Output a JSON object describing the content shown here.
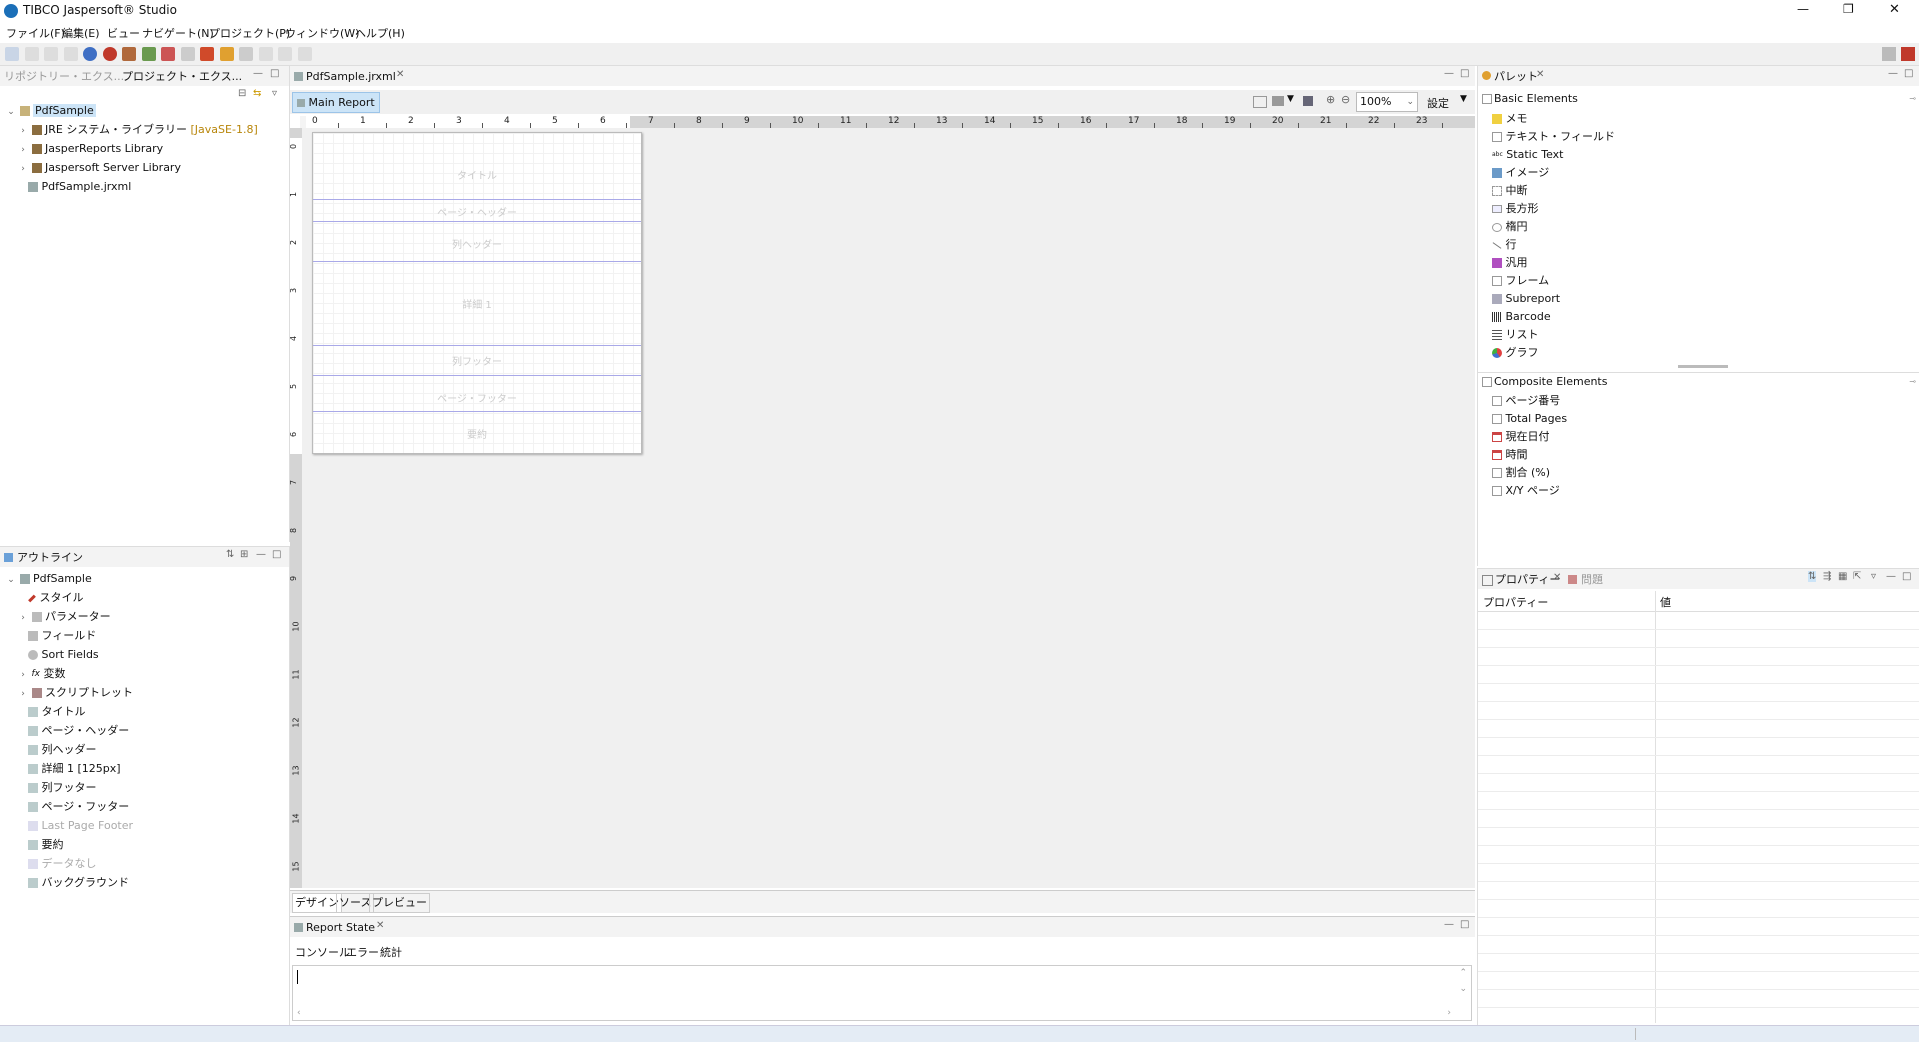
{
  "window": {
    "title": "TIBCO Jaspersoft® Studio",
    "controls": {
      "minimize": "—",
      "maximize": "❐",
      "close": "✕"
    }
  },
  "menu": [
    "ファイル(F)",
    "編集(E)",
    "ビュー",
    "ナビゲート(N)",
    "プロジェクト(P)",
    "ウィンドウ(W)",
    "ヘルプ(H)"
  ],
  "project_panel": {
    "tabs": [
      "リポジトリー・エクス...",
      "プロジェクト・エクス..."
    ],
    "tree": [
      {
        "label": "PdfSample",
        "level": 0,
        "expanded": true,
        "selected": true
      },
      {
        "label": "JRE システム・ライブラリー",
        "suffix": "[JavaSE-1.8]",
        "level": 1
      },
      {
        "label": "JasperReports Library",
        "level": 1
      },
      {
        "label": "Jaspersoft Server Library",
        "level": 1
      },
      {
        "label": "PdfSample.jrxml",
        "level": 1
      }
    ]
  },
  "outline_panel": {
    "title": "アウトライン",
    "items": [
      {
        "label": "PdfSample",
        "level": 0,
        "expanded": true
      },
      {
        "label": "スタイル",
        "level": 1
      },
      {
        "label": "パラメーター",
        "level": 1,
        "expandable": true
      },
      {
        "label": "フィールド",
        "level": 1
      },
      {
        "label": "Sort Fields",
        "level": 1
      },
      {
        "label": "変数",
        "level": 1,
        "expandable": true
      },
      {
        "label": "スクリプトレット",
        "level": 1,
        "expandable": true
      },
      {
        "label": "タイトル",
        "level": 1
      },
      {
        "label": "ページ・ヘッダー",
        "level": 1
      },
      {
        "label": "列ヘッダー",
        "level": 1
      },
      {
        "label": "詳細 1 [125px]",
        "level": 1
      },
      {
        "label": "列フッター",
        "level": 1
      },
      {
        "label": "ページ・フッター",
        "level": 1
      },
      {
        "label": "Last Page Footer",
        "level": 1,
        "disabled": true
      },
      {
        "label": "要約",
        "level": 1
      },
      {
        "label": "データなし",
        "level": 1,
        "disabled": true
      },
      {
        "label": "バックグラウンド",
        "level": 1
      }
    ]
  },
  "editor": {
    "file_tab": "PdfSample.jrxml",
    "report_tab": "Main Report",
    "zoom": "100%",
    "settings_label": "設定",
    "ruler_numbers": [
      "0",
      "1",
      "2",
      "3",
      "4",
      "5",
      "6",
      "7",
      "8",
      "9",
      "10",
      "11",
      "12",
      "13",
      "14",
      "15",
      "16",
      "17",
      "18",
      "19",
      "20",
      "21",
      "22",
      "23"
    ],
    "vruler_numbers": [
      "0",
      "1",
      "2",
      "3",
      "4",
      "5",
      "6",
      "7",
      "8",
      "9",
      "10",
      "11",
      "12",
      "13",
      "14",
      "15"
    ],
    "bands": [
      "タイトル",
      "ページ・ヘッダー",
      "列ヘッダー",
      "詳細 1",
      "列フッター",
      "ページ・フッター",
      "要約"
    ],
    "bottom_tabs": [
      "デザイン",
      "ソース",
      "プレビュー"
    ]
  },
  "report_state": {
    "title": "Report State",
    "tabs": [
      "コンソール",
      "エラー",
      "統計"
    ]
  },
  "palette": {
    "title": "パレット",
    "basic_title": "Basic Elements",
    "basic": [
      "メモ",
      "テキスト・フィールド",
      "Static Text",
      "イメージ",
      "中断",
      "長方形",
      "楕円",
      "行",
      "汎用",
      "フレーム",
      "Subreport",
      "Barcode",
      "リスト",
      "グラフ"
    ],
    "composite_title": "Composite Elements",
    "composite": [
      "ページ番号",
      "Total Pages",
      "現在日付",
      "時間",
      "割合 (%)",
      "X/Y ページ"
    ]
  },
  "properties": {
    "tabs": [
      "プロパティー",
      "問題"
    ],
    "col_property": "プロパティー",
    "col_value": "値"
  },
  "colors": {
    "selection": "#cce4f7",
    "band_line": "#a9a9e8",
    "ruler_bg": "#d4d4d4",
    "chrome": "#f0f0f0"
  }
}
